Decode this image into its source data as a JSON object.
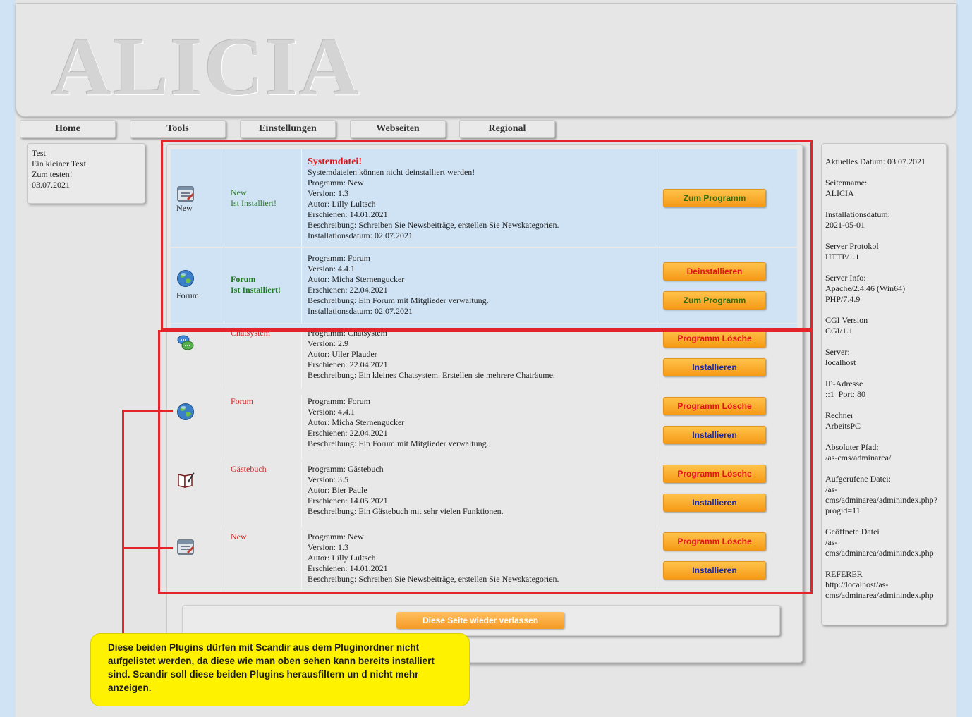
{
  "header": {
    "logo": "ALICIA"
  },
  "nav": [
    {
      "label": "Home"
    },
    {
      "label": "Tools"
    },
    {
      "label": "Einstellungen"
    },
    {
      "label": "Webseiten"
    },
    {
      "label": "Regional"
    }
  ],
  "leftbox": {
    "lines": [
      "Test",
      "Ein kleiner Text",
      "Zum testen!",
      "03.07.2021"
    ]
  },
  "installed": [
    {
      "icon": "news-icon",
      "icon_label": "New",
      "name_line1": "New",
      "name_line2": "Ist Installiert!",
      "title": "Systemdatei!",
      "subtitle": "Systemdateien können nicht deinstalliert werden!",
      "lines": [
        "Programm: New",
        "Version: 1.3",
        "Autor: Lilly Lultsch",
        "Erschienen: 14.01.2021",
        "Beschreibung: Schreiben Sie Newsbeiträge, erstellen Sie Newskategorien.",
        "Installationsdatum: 02.07.2021"
      ],
      "button_program": "Zum Programm"
    },
    {
      "icon": "globe-icon",
      "icon_label": "Forum",
      "name_line1": "Forum",
      "name_line2": "Ist Installiert!",
      "lines": [
        "Programm: Forum",
        "Version: 4.4.1",
        "Autor: Micha Sternengucker",
        "Erschienen: 22.04.2021",
        "Beschreibung: Ein Forum mit Mitglieder verwaltung.",
        "Installationsdatum: 02.07.2021"
      ],
      "button_uninstall": "Deinstallieren",
      "button_program": "Zum Programm"
    }
  ],
  "available": [
    {
      "icon": "chat-icon",
      "name": "Chatsystem",
      "lines": [
        "Programm: Chatsystem",
        "Version: 2.9",
        "Autor: Uller Plauder",
        "Erschienen: 22.04.2021",
        "Beschreibung: Ein kleines Chatsystem. Erstellen sie mehrere Chaträume."
      ],
      "button_delete": "Programm Lösche",
      "button_install": "Installieren"
    },
    {
      "icon": "globe-icon",
      "name": "Forum",
      "lines": [
        "Programm: Forum",
        "Version: 4.4.1",
        "Autor: Micha Sternengucker",
        "Erschienen: 22.04.2021",
        "Beschreibung: Ein Forum mit Mitglieder verwaltung."
      ],
      "button_delete": "Programm Lösche",
      "button_install": "Installieren"
    },
    {
      "icon": "guestbook-icon",
      "name": "Gästebuch",
      "lines": [
        "Programm: Gästebuch",
        "Version: 3.5",
        "Autor: Bier Paule",
        "Erschienen: 14.05.2021",
        "Beschreibung: Ein Gästebuch mit sehr vielen Funktionen."
      ],
      "button_delete": "Programm Lösche",
      "button_install": "Installieren"
    },
    {
      "icon": "news-icon",
      "name": "New",
      "lines": [
        "Programm: New",
        "Version: 1.3",
        "Autor: Lilly Lultsch",
        "Erschienen: 14.01.2021",
        "Beschreibung: Schreiben Sie Newsbeiträge, erstellen Sie Newskategorien."
      ],
      "button_delete": "Programm Lösche",
      "button_install": "Installieren"
    }
  ],
  "leave_button": "Diese Seite wieder verlassen",
  "info": [
    "Aktuelles Datum: 03.07.2021",
    "Seitenname:\nALICIA",
    "Installationsdatum:\n2021-05-01",
    "Server Protokol\nHTTP/1.1",
    "Server Info:\nApache/2.4.46 (Win64)\nPHP/7.4.9",
    "CGI Version\nCGI/1.1",
    "Server:\nlocalhost",
    "IP-Adresse\n::1  Port: 80",
    "Rechner\nArbeitsPC",
    "Absoluter Pfad:\n/as-cms/adminarea/",
    "Aufgerufene Datei:\n/as-\ncms/adminarea/adminindex.php?\nprogid=11",
    "Geöffnete Datei\n/as-\ncms/adminarea/adminindex.php",
    "REFERER\nhttp://localhost/as-\ncms/adminarea/adminindex.php"
  ],
  "annotation": "Diese beiden Plugins dürfen mit Scandir aus dem Pluginordner nicht aufgelistet werden, da diese wie man oben sehen kann bereits installiert sind. Scandir soll diese beiden Plugins herausfiltern un d nicht mehr anzeigen.",
  "colors": {
    "annotation_red": "#e5232b",
    "note_yellow": "#fff200",
    "button_orange": "#f59a17"
  }
}
